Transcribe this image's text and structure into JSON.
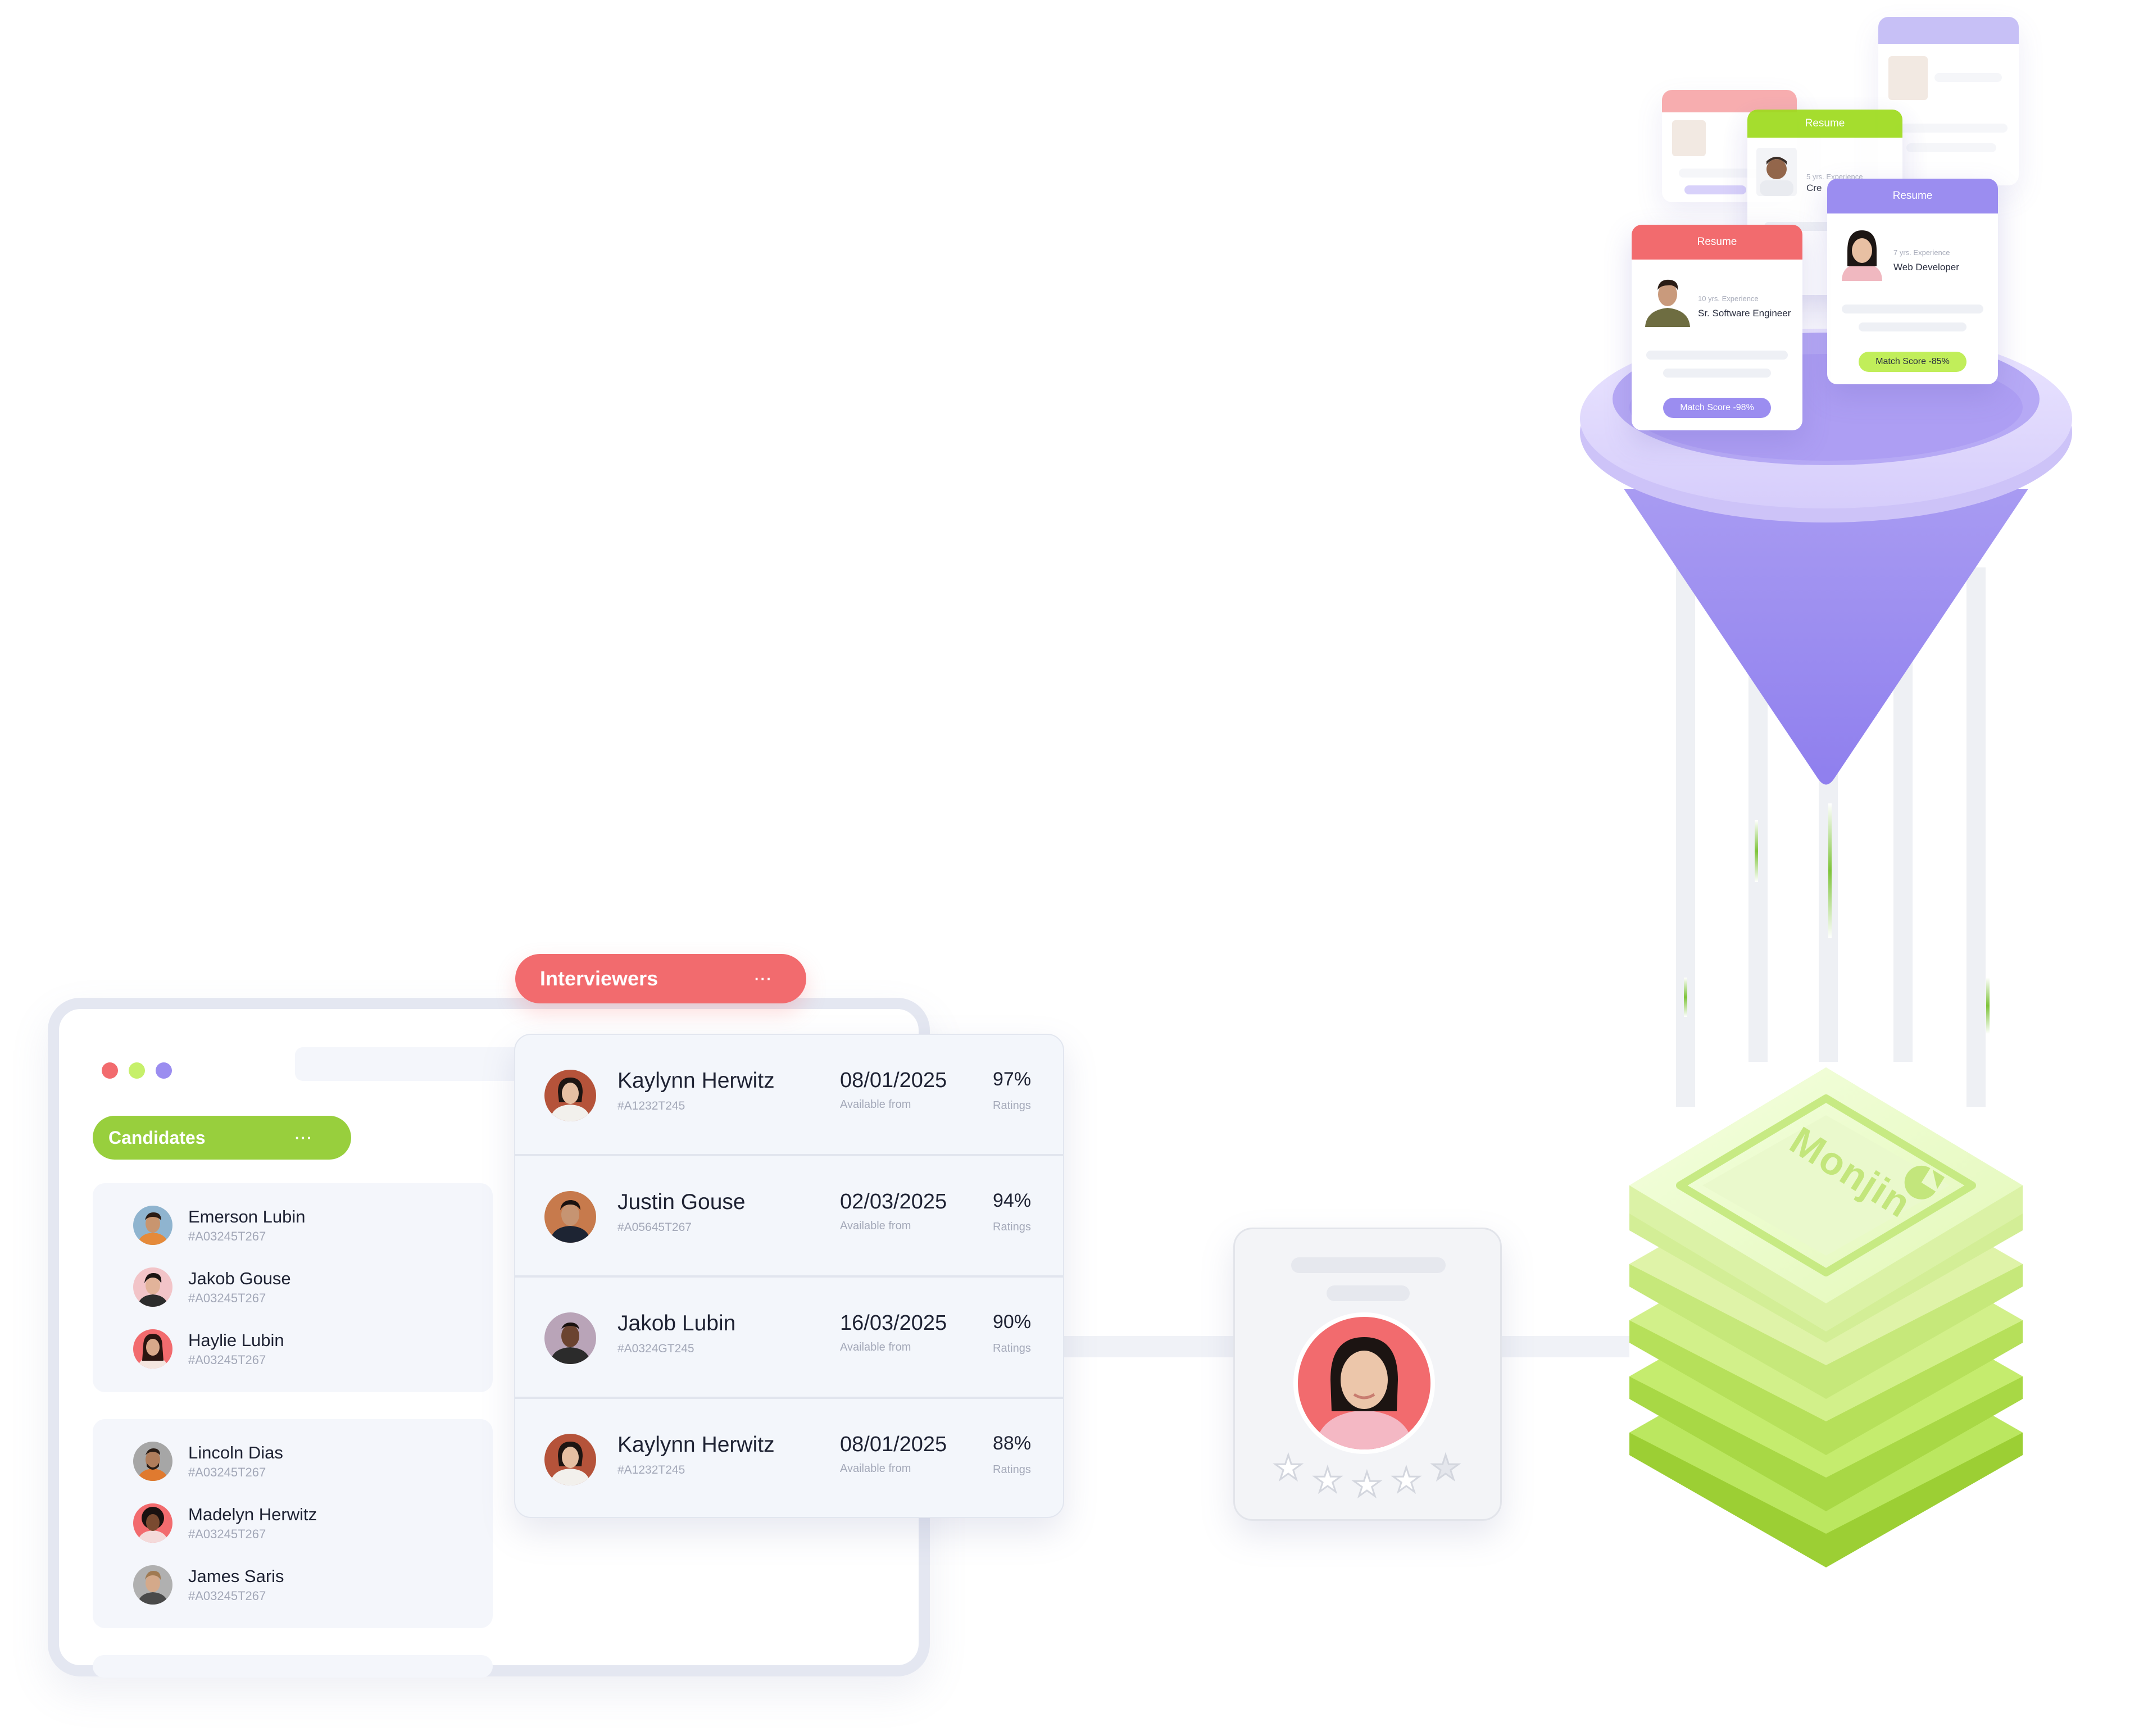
{
  "colors": {
    "red": "#f26b6e",
    "green": "#98cf3d",
    "purple": "#9b8df0",
    "text": "#1e2233",
    "muted": "#a3a8b8"
  },
  "window_controls": [
    "close-dot",
    "minimize-dot",
    "maximize-dot"
  ],
  "candidates": {
    "label": "Candidates",
    "more": "···",
    "groups": [
      [
        {
          "name": "Emerson Lubin",
          "id": "#A03245T267"
        },
        {
          "name": "Jakob Gouse",
          "id": "#A03245T267"
        },
        {
          "name": "Haylie Lubin",
          "id": "#A03245T267"
        }
      ],
      [
        {
          "name": "Lincoln Dias",
          "id": "#A03245T267"
        },
        {
          "name": "Madelyn Herwitz",
          "id": "#A03245T267"
        },
        {
          "name": "James Saris",
          "id": "#A03245T267"
        }
      ]
    ]
  },
  "interviewers": {
    "label": "Interviewers",
    "more": "···",
    "rows": [
      {
        "name": "Kaylynn Herwitz",
        "id": "#A1232T245",
        "date": "08/01/2025",
        "date_label": "Available from",
        "rating": "97%",
        "rating_label": "Ratings"
      },
      {
        "name": "Justin Gouse",
        "id": "#A05645T267",
        "date": "02/03/2025",
        "date_label": "Available from",
        "rating": "94%",
        "rating_label": "Ratings"
      },
      {
        "name": "Jakob Lubin",
        "id": "#A0324GT245",
        "date": "16/03/2025",
        "date_label": "Available from",
        "rating": "90%",
        "rating_label": "Ratings"
      },
      {
        "name": "Kaylynn Herwitz",
        "id": "#A1232T245",
        "date": "08/01/2025",
        "date_label": "Available from",
        "rating": "88%",
        "rating_label": "Ratings"
      }
    ]
  },
  "profile": {
    "stars": [
      "★",
      "★",
      "★",
      "★",
      "★"
    ],
    "rating_value": 0
  },
  "resumes": [
    {
      "header": "Resume",
      "experience": "10 yrs. Experience",
      "role": "Sr. Software Engineer",
      "score": "Match Score -98%"
    },
    {
      "header": "Resume",
      "experience": "7 yrs. Experience",
      "role": "Web Developer",
      "score": "Match Score -85%"
    },
    {
      "header": "Resume",
      "experience": "5 yrs. Experience",
      "role": "Cre",
      "score": ""
    }
  ],
  "brand": {
    "name": "Monjin"
  }
}
